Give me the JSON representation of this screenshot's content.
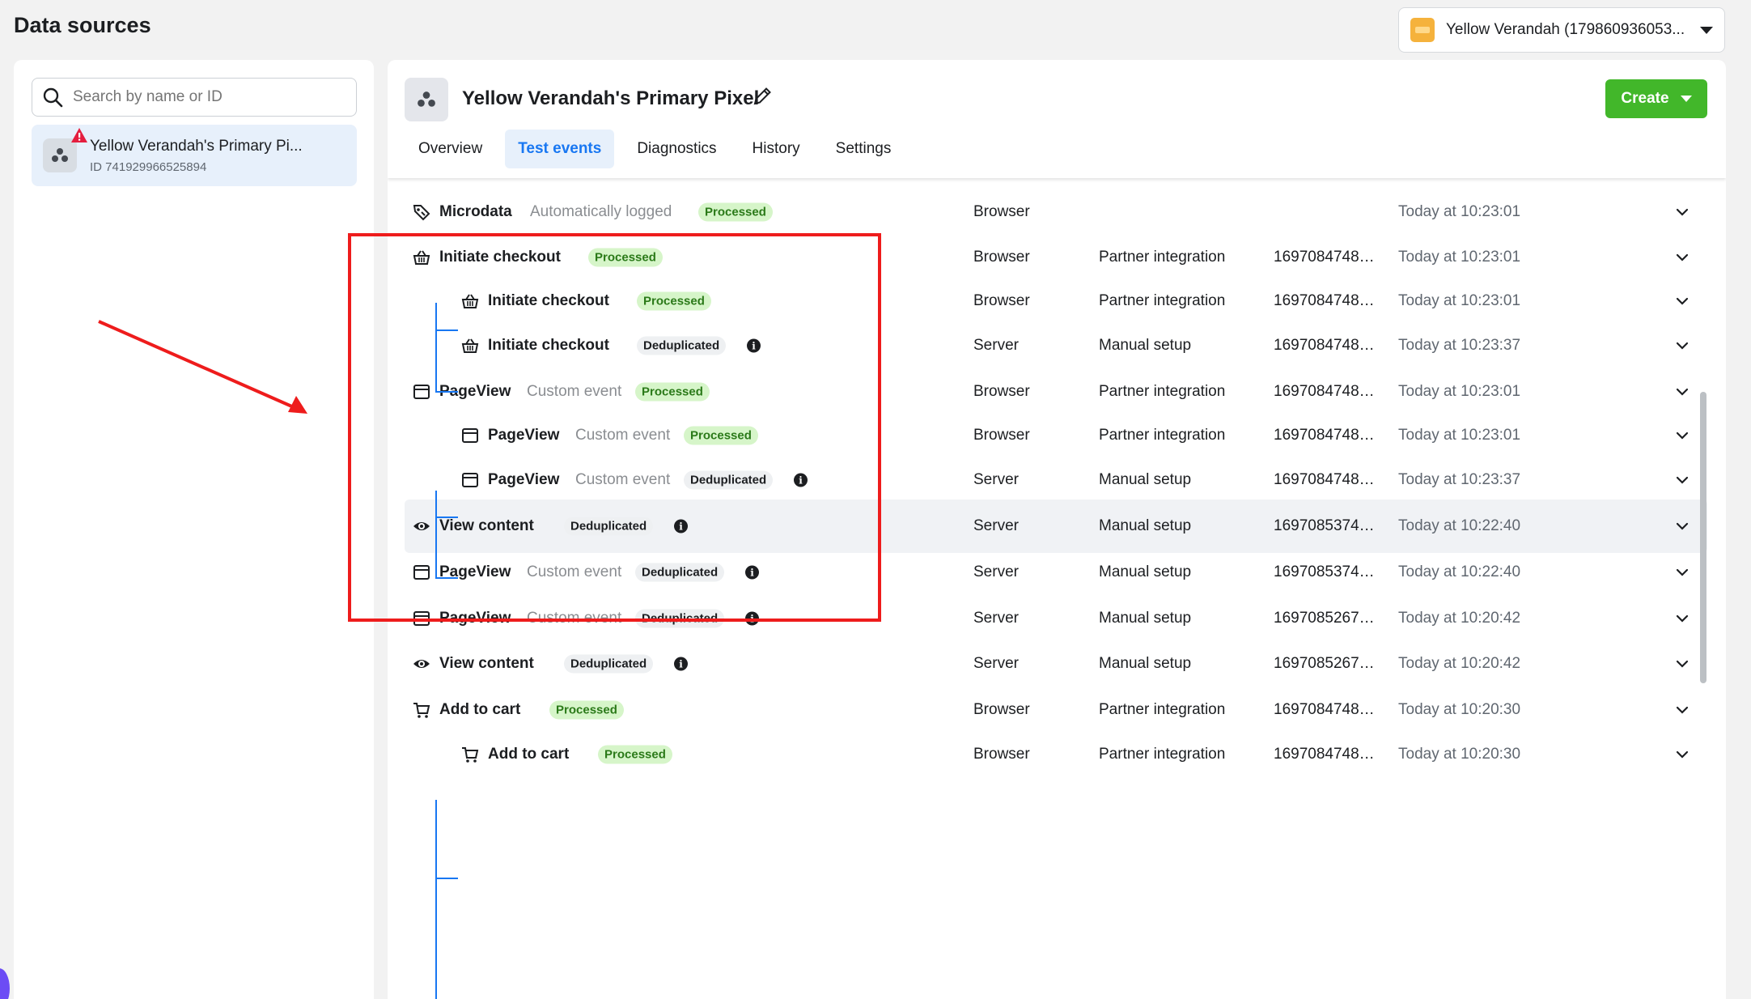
{
  "page": {
    "title": "Data sources"
  },
  "account": {
    "name": "Yellow Verandah (179860936053..."
  },
  "left": {
    "search_placeholder": "Search by name or ID",
    "source": {
      "name": "Yellow Verandah's Primary Pi...",
      "id_text": "ID 741929966525894"
    }
  },
  "main": {
    "pixel_name": "Yellow Verandah's Primary Pixel",
    "create_label": "Create",
    "tabs": [
      "Overview",
      "Test events",
      "Diagnostics",
      "History",
      "Settings"
    ],
    "active_tab": "Test events"
  },
  "events": [
    {
      "name": "Microdata",
      "sub": "Automatically logged",
      "status": "Processed",
      "icon": "tag-icon",
      "source": "Browser",
      "setup": "",
      "event_id": "",
      "time": "Today at 10:23:01",
      "child": false
    },
    {
      "name": "Initiate checkout",
      "sub": "",
      "status": "Processed",
      "icon": "basket-icon",
      "source": "Browser",
      "setup": "Partner integration",
      "event_id": "16970847483...",
      "time": "Today at 10:23:01",
      "child": false
    },
    {
      "name": "Initiate checkout",
      "sub": "",
      "status": "Processed",
      "icon": "basket-icon",
      "source": "Browser",
      "setup": "Partner integration",
      "event_id": "16970847483...",
      "time": "Today at 10:23:01",
      "child": true
    },
    {
      "name": "Initiate checkout",
      "sub": "",
      "status": "Deduplicated",
      "icon": "basket-icon",
      "source": "Server",
      "setup": "Manual setup",
      "event_id": "16970847483...",
      "time": "Today at 10:23:37",
      "child": true
    },
    {
      "name": "PageView",
      "sub": "Custom event",
      "status": "Processed",
      "icon": "browser-window-icon",
      "source": "Browser",
      "setup": "Partner integration",
      "event_id": "16970847483...",
      "time": "Today at 10:23:01",
      "child": false
    },
    {
      "name": "PageView",
      "sub": "Custom event",
      "status": "Processed",
      "icon": "browser-window-icon",
      "source": "Browser",
      "setup": "Partner integration",
      "event_id": "16970847483...",
      "time": "Today at 10:23:01",
      "child": true
    },
    {
      "name": "PageView",
      "sub": "Custom event",
      "status": "Deduplicated",
      "icon": "browser-window-icon",
      "source": "Server",
      "setup": "Manual setup",
      "event_id": "16970847483...",
      "time": "Today at 10:23:37",
      "child": true
    },
    {
      "name": "View content",
      "sub": "",
      "status": "Deduplicated",
      "icon": "eye-icon",
      "source": "Server",
      "setup": "Manual setup",
      "event_id": "16970853747...",
      "time": "Today at 10:22:40",
      "child": false
    },
    {
      "name": "PageView",
      "sub": "Custom event",
      "status": "Deduplicated",
      "icon": "browser-window-icon",
      "source": "Server",
      "setup": "Manual setup",
      "event_id": "16970853747...",
      "time": "Today at 10:22:40",
      "child": false
    },
    {
      "name": "PageView",
      "sub": "Custom event",
      "status": "Deduplicated",
      "icon": "browser-window-icon",
      "source": "Server",
      "setup": "Manual setup",
      "event_id": "16970852675...",
      "time": "Today at 10:20:42",
      "child": false
    },
    {
      "name": "View content",
      "sub": "",
      "status": "Deduplicated",
      "icon": "eye-icon",
      "source": "Server",
      "setup": "Manual setup",
      "event_id": "16970852675...",
      "time": "Today at 10:20:42",
      "child": false
    },
    {
      "name": "Add to cart",
      "sub": "",
      "status": "Processed",
      "icon": "cart-icon",
      "source": "Browser",
      "setup": "Partner integration",
      "event_id": "16970847483...",
      "time": "Today at 10:20:30",
      "child": false
    },
    {
      "name": "Add to cart",
      "sub": "",
      "status": "Processed",
      "icon": "cart-icon",
      "source": "Browser",
      "setup": "Partner integration",
      "event_id": "16970847483...",
      "time": "Today at 10:20:30",
      "child": true
    }
  ],
  "colors": {
    "accent": "#1877f2",
    "create": "#42b72a",
    "processed_bg": "#d6f5c9",
    "annotation": "#ee1c1c"
  }
}
